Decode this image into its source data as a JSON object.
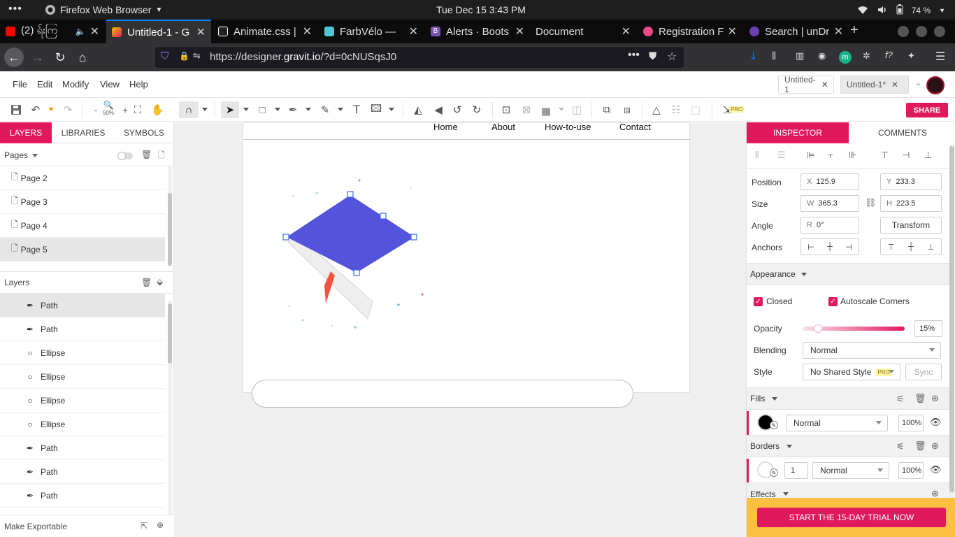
{
  "system": {
    "app_name": "Firefox Web Browser",
    "datetime": "Tue Dec 15   3:43 PM",
    "battery": "74 %"
  },
  "browser": {
    "tabs": [
      {
        "label": "(2) ရ်းကြ",
        "favicon_color": "#ff0000"
      },
      {
        "label": "Untitled-1 - G",
        "favicon_color": "#f5c400"
      },
      {
        "label": "Animate.css |",
        "favicon_color": "#ffffff"
      },
      {
        "label": "FarbVélo —",
        "favicon_color": "#4ec6d6"
      },
      {
        "label": "Alerts · Boots",
        "favicon_color": "#7952b3"
      },
      {
        "label": "Document",
        "favicon_color": ""
      },
      {
        "label": "Registration F",
        "favicon_color": "#ea4c89"
      },
      {
        "label": "Search | unDr",
        "favicon_color": "#6c3fb5"
      }
    ],
    "url_prefix": "https://designer.",
    "url_domain": "gravit.io",
    "url_suffix": "/?d=0cNUSqsJ0"
  },
  "menu": {
    "items": [
      "File",
      "Edit",
      "Modify",
      "View",
      "Help"
    ],
    "doc_tabs": [
      "Untitled-1",
      "Untitled-1*"
    ]
  },
  "toolbar": {
    "zoom": "50%",
    "share": "SHARE",
    "pro": "PRO"
  },
  "left": {
    "tabs": [
      "LAYERS",
      "LIBRARIES",
      "SYMBOLS"
    ],
    "pages_label": "Pages",
    "pages": [
      "Page 2",
      "Page 3",
      "Page 4",
      "Page 5"
    ],
    "layers_label": "Layers",
    "layers": [
      {
        "type": "Path",
        "icon": "pen-icon"
      },
      {
        "type": "Path",
        "icon": "pen-icon"
      },
      {
        "type": "Ellipse",
        "icon": "ellipse-icon"
      },
      {
        "type": "Ellipse",
        "icon": "ellipse-icon"
      },
      {
        "type": "Ellipse",
        "icon": "ellipse-icon"
      },
      {
        "type": "Ellipse",
        "icon": "ellipse-icon"
      },
      {
        "type": "Path",
        "icon": "pen-icon"
      },
      {
        "type": "Path",
        "icon": "pen-icon"
      },
      {
        "type": "Path",
        "icon": "pen-icon"
      }
    ],
    "make_exportable": "Make Exportable"
  },
  "artboard": {
    "nav": [
      "Home",
      "About",
      "How-to-use",
      "Contact"
    ],
    "shape_color": "#5353db"
  },
  "inspector": {
    "tabs": [
      "INSPECTOR",
      "COMMENTS"
    ],
    "position_label": "Position",
    "x_label": "X",
    "x": "125.9",
    "y_label": "Y",
    "y": "233.3",
    "size_label": "Size",
    "w_label": "W",
    "w": "365.3",
    "h_label": "H",
    "h": "223.5",
    "angle_label": "Angle",
    "r_label": "R",
    "angle": "0°",
    "transform": "Transform",
    "anchors_label": "Anchors",
    "appearance_label": "Appearance",
    "closed": "Closed",
    "autoscale": "Autoscale Corners",
    "opacity_label": "Opacity",
    "opacity": "15%",
    "opacity_value": 0.15,
    "blending_label": "Blending",
    "blending": "Normal",
    "style_label": "Style",
    "style": "No Shared Style",
    "sync": "Sync",
    "fills_label": "Fills",
    "fill_blend": "Normal",
    "fill_opacity": "100%",
    "fill_color": "#000000",
    "borders_label": "Borders",
    "border_width": "1",
    "border_blend": "Normal",
    "border_opacity": "100%",
    "effects_label": "Effects",
    "trial": "START THE 15-DAY TRIAL NOW"
  },
  "colors": {
    "accent": "#e0195d",
    "trial_bar": "#fec042"
  }
}
